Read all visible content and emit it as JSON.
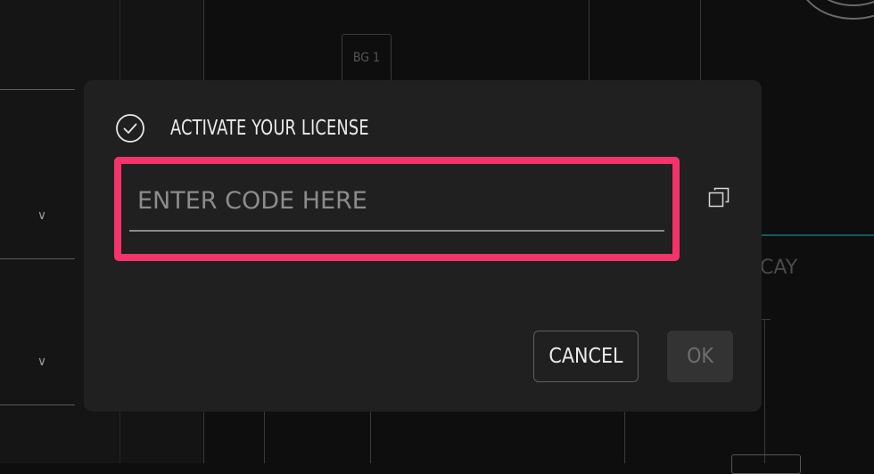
{
  "background": {
    "badge_text": "BG 1",
    "partial_label": "CAY"
  },
  "dialog": {
    "title": "ACTIVATE YOUR LICENSE",
    "code_input": {
      "value": "",
      "placeholder": "ENTER CODE HERE"
    },
    "cancel_label": "CANCEL",
    "ok_label": "OK",
    "highlight_color": "#f5336b"
  }
}
